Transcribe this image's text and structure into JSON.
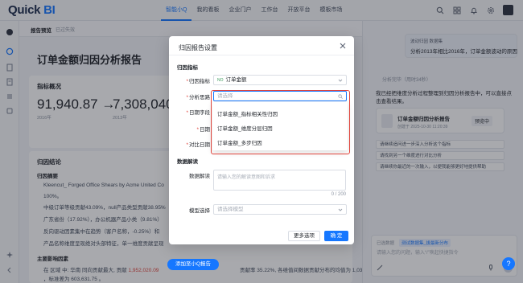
{
  "brand": {
    "logo_text": "Quick",
    "logo_accent": "BI"
  },
  "nav": [
    "智能小Q",
    "我的看板",
    "企业门户",
    "工作台",
    "开放平台",
    "模板市场"
  ],
  "report": {
    "crumb": "报告预览",
    "crumb_tag": "已过失效",
    "title": "订单金额归因分析报告",
    "overview_title": "指标概况",
    "value_from": "91,940.87 →",
    "value_to": "7,308,040.5",
    "year_from": "2016年",
    "year_to": "2013年",
    "conclusion_title": "归因结论",
    "summary_title": "归因摘要",
    "lines": [
      "Kleencut_ Forged Office Shears by Acme United Co",
      "100%。",
      "中级订单等级贡献43.09%，null产品类型贡献38.95%",
      "广东省份（17.92%），办公机器产品小类（9.81%）",
      "反向驱动因素集中在趋势（客户名称，-0.25%）和",
      "产品名称维度呈现绝对头部特征，单一维度贡献呈现"
    ],
    "main_title": "主要影响因素",
    "region_line_a": "在 区域 中: 华南 同向贡献最大, 贡献",
    "region_line_red": "1,952,020.09",
    "region_line_b": "贡献率 35.22%, 各维值间数据贡献分布的均值为 1,030,871.40",
    "region_line_c": "，标准差为 603,631.75 。",
    "add_to_q": "添加至小Q报告"
  },
  "modal": {
    "title": "归因报告设置",
    "section_metric": "归因指标",
    "labels": {
      "metric": "归因指标",
      "idea": "分析思路",
      "date_field": "日期字段",
      "date": "日期",
      "compare_date": "对比日期"
    },
    "metric_value": "订单金额",
    "metric_tag": "NO",
    "idea_placeholder": "请选择",
    "dropdown_options": [
      "订单金额_指标相关性归因",
      "订单金额_维度分层归因",
      "订单金额_多步归因"
    ],
    "section_interpret": "数据解读",
    "interpret_label": "数据解读",
    "interpret_placeholder": "请输入您的解读意图和诉求",
    "counter": "0 / 200",
    "model_label": "模型选择",
    "model_placeholder": "请选择模型",
    "btn_more": "更多选项",
    "btn_ok": "确 定"
  },
  "right": {
    "query_tag": "波动归因 数据集",
    "query_text": "分析2013年相比2016年，订单金额波动的原因",
    "think_label": "分析完毕（用时34秒）",
    "answer": "我已经把维度分析过程整理到归因分析报告中，可以直接点击查看结果。",
    "report_card_title": "订单金额归因分析报告",
    "report_card_time": "创建于 2025-10-30 11:20:39",
    "preview_btn": "预览中",
    "suggest": [
      "请继续追问进一步深入分析这个指标",
      "请找到另一个维度进行对比分析",
      "请继续你最近的一次输入，以便我能够更好地提供帮助"
    ],
    "input_source": "已选数据",
    "input_source_chip": "测试数据集_拔最新分布",
    "input_placeholder": "请输入您的问题，输入“/”唤起快捷指令"
  },
  "colors": {
    "accent": "#1677ff",
    "danger": "#e0443c"
  },
  "icons": [
    "search-icon",
    "bell-icon",
    "help-icon",
    "settings-icon",
    "close-icon",
    "chevron-down-icon",
    "mic-icon",
    "send-icon"
  ]
}
